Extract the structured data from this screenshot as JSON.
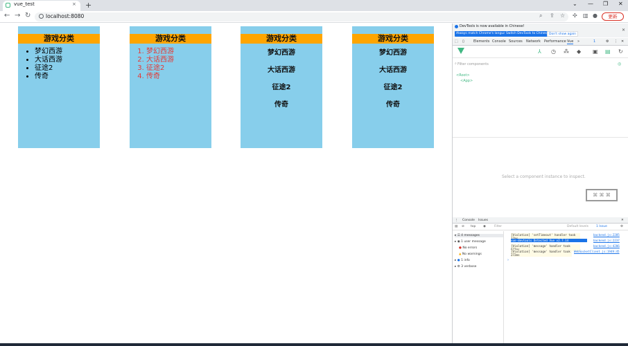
{
  "browser": {
    "tab_title": "vue_test",
    "tab_close": "×",
    "new_tab": "+",
    "url": "localhost:8080",
    "update_label": "更新",
    "win_minimize": "—",
    "win_restore": "❐",
    "win_close": "✕",
    "win_tabsearch": "⌄"
  },
  "page": {
    "cards": [
      {
        "title": "游戏分类",
        "kind": "ul",
        "items": [
          "梦幻西游",
          "大话西游",
          "征途2",
          "传奇"
        ]
      },
      {
        "title": "游戏分类",
        "kind": "ol",
        "items": [
          "梦幻西游",
          "大话西游",
          "征途2",
          "传奇"
        ]
      },
      {
        "title": "游戏分类",
        "kind": "h4",
        "items": [
          "梦幻西游",
          "大话西游",
          "征途2",
          "传奇"
        ]
      },
      {
        "title": "游戏分类",
        "kind": "h4",
        "items": [
          "梦幻西游",
          "大话西游",
          "征途2",
          "传奇"
        ]
      }
    ]
  },
  "devtools": {
    "banner_text": "DevTools is now available in Chinese!",
    "banner_btn_match": "Always match Chrome's language",
    "banner_btn_switch": "Switch DevTools to Chinese",
    "banner_btn_dont": "Don't show again",
    "tabs": [
      "Elements",
      "Console",
      "Sources",
      "Network",
      "Performance",
      "Vue"
    ],
    "badge": "1",
    "filter_placeholder": "Filter components",
    "tree_root": "<Root>",
    "tree_app": "<App>",
    "select_hint": "Select a component instance to inspect.",
    "console_tabs": [
      "Console",
      "Issues"
    ],
    "console_context": "top",
    "console_filter": "Filter",
    "console_levels": "Default levels",
    "console_issue": "1 Issue",
    "sidebar": [
      "4 messages",
      "1 user message",
      "No errors",
      "No warnings",
      "1 info",
      "3 verbose"
    ],
    "messages": [
      {
        "text": "[Violation] 'setTimeout' handler took 17ms",
        "link": "backend.js:2285"
      },
      {
        "text": "vue-devtools  Detected Vue v2.7.14",
        "link": "backend.js:2237"
      },
      {
        "text": "[Violation] 'message' handler took 677ms",
        "link": "backend.js:4206"
      },
      {
        "text": "[Violation] 'message' handler took 272ms",
        "link": "WebSocketClient.js:1949:45"
      }
    ]
  }
}
